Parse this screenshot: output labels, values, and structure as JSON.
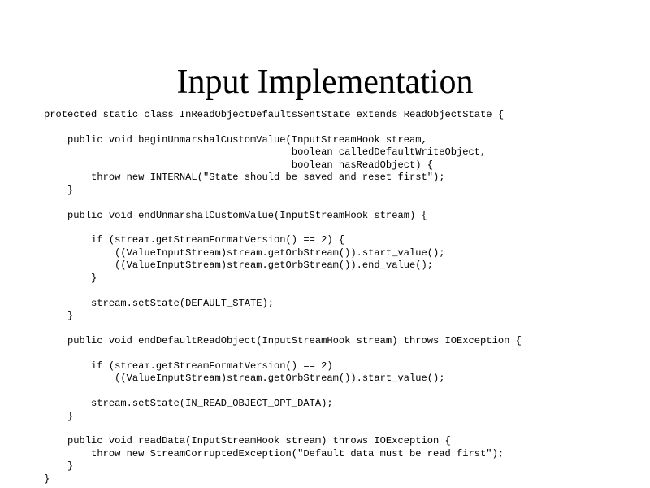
{
  "slide": {
    "title": "Input Implementation",
    "code_lines": [
      "protected static class InReadObjectDefaultsSentState extends ReadObjectState {",
      "",
      "    public void beginUnmarshalCustomValue(InputStreamHook stream,",
      "                                          boolean calledDefaultWriteObject,",
      "                                          boolean hasReadObject) {",
      "        throw new INTERNAL(\"State should be saved and reset first\");",
      "    }",
      "",
      "    public void endUnmarshalCustomValue(InputStreamHook stream) {",
      "",
      "        if (stream.getStreamFormatVersion() == 2) {",
      "            ((ValueInputStream)stream.getOrbStream()).start_value();",
      "            ((ValueInputStream)stream.getOrbStream()).end_value();",
      "        }",
      "",
      "        stream.setState(DEFAULT_STATE);",
      "    }",
      "",
      "    public void endDefaultReadObject(InputStreamHook stream) throws IOException {",
      "",
      "        if (stream.getStreamFormatVersion() == 2)",
      "            ((ValueInputStream)stream.getOrbStream()).start_value();",
      "",
      "        stream.setState(IN_READ_OBJECT_OPT_DATA);",
      "    }",
      "",
      "    public void readData(InputStreamHook stream) throws IOException {",
      "        throw new StreamCorruptedException(\"Default data must be read first\");",
      "    }",
      "}"
    ]
  }
}
